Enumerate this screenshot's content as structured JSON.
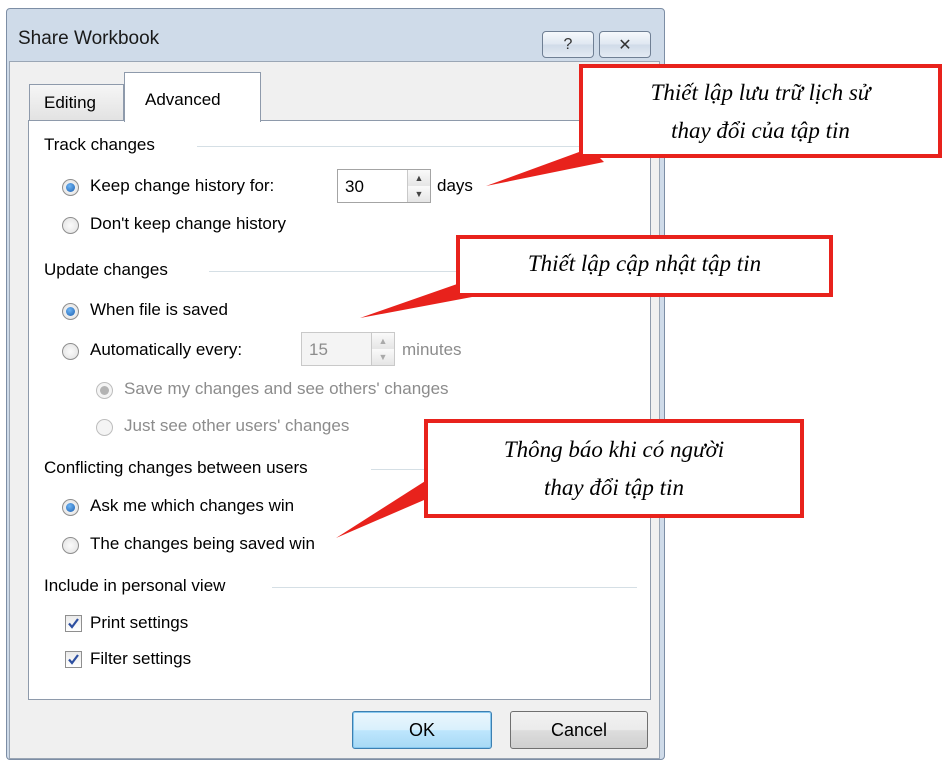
{
  "dialog": {
    "title": "Share Workbook",
    "help_glyph": "?",
    "close_glyph": "✕",
    "tabs": [
      {
        "label": "Editing",
        "selected": false
      },
      {
        "label": "Advanced",
        "selected": true
      }
    ]
  },
  "track_changes": {
    "header": "Track changes",
    "keep_history_label": "Keep change history for:",
    "days_value": "30",
    "days_unit": "days",
    "dont_keep_label": "Don't keep change history",
    "selected": "keep"
  },
  "update_changes": {
    "header": "Update changes",
    "when_saved_label": "When file is saved",
    "auto_label": "Automatically every:",
    "minutes_value": "15",
    "minutes_unit": "minutes",
    "save_and_see_label": "Save my changes and see others' changes",
    "just_see_label": "Just see other users' changes",
    "selected": "when_saved"
  },
  "conflicts": {
    "header": "Conflicting changes between users",
    "ask_me_label": "Ask me which changes win",
    "being_saved_label": "The changes being saved win",
    "selected": "ask_me"
  },
  "personal_view": {
    "header": "Include in personal view",
    "print_label": "Print settings",
    "print_checked": true,
    "filter_label": "Filter settings",
    "filter_checked": true
  },
  "buttons": {
    "ok": "OK",
    "cancel": "Cancel"
  },
  "annotations": {
    "track": [
      "Thiết lập lưu trữ lịch sử",
      "thay đổi của tập tin"
    ],
    "update": [
      "Thiết lập cập nhật  tập tin"
    ],
    "conflict": [
      "Thông báo khi có người",
      "thay đổi tập tin"
    ],
    "color": "#e8221c"
  },
  "colors": {
    "radio_selected": "#1d5fb0",
    "checkmark": "#2d4fa0",
    "ok_border": "#3c7fb1"
  }
}
